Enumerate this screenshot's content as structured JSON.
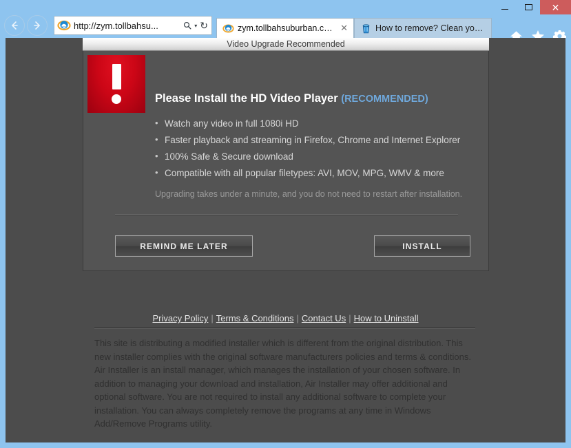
{
  "browser": {
    "window_controls": {
      "minimize": "–",
      "maximize": "□",
      "close": "✕"
    },
    "nav": {
      "back_icon": "back-arrow-icon",
      "forward_icon": "forward-arrow-icon"
    },
    "address_bar": {
      "value": "http://zym.tollbahsu...",
      "placeholder": "",
      "search_icon": "search-icon",
      "dropdown_icon": "▾",
      "refresh_icon": "↻"
    },
    "tabs": [
      {
        "label": "zym.tollbahsuburban.com",
        "icon": "ie-logo-icon",
        "close": "✕",
        "active": true
      },
      {
        "label": "How to remove? Clean your co...",
        "icon": "trash-bin-icon",
        "active": false
      }
    ],
    "toolbar_right": [
      {
        "name": "home-icon"
      },
      {
        "name": "favorites-star-icon"
      },
      {
        "name": "settings-gear-icon"
      }
    ]
  },
  "page": {
    "dialog": {
      "title": "Video Upgrade Recommended",
      "alert_icon": "exclamation-mark-icon",
      "headline": "Please Install the HD Video Player",
      "headline_suffix": "(RECOMMENDED)",
      "bullets": [
        "Watch any video in full 1080i HD",
        "Faster playback and streaming in Firefox, Chrome and Internet Explorer",
        "100% Safe & Secure download",
        "Compatible with all popular filetypes: AVI, MOV,  MPG, WMV & more"
      ],
      "subnote": "Upgrading takes under a minute, and you do not need to restart after installation.",
      "buttons": {
        "remind": "REMIND ME LATER",
        "install": "INSTALL"
      }
    },
    "footer": {
      "links": [
        "Privacy Policy",
        "Terms & Conditions",
        "Contact Us",
        "How to Uninstall"
      ],
      "separator": "|",
      "disclaimer": "This site is distributing a modified installer which is different from the original distribution. This new installer complies with the original software manufacturers policies and terms & conditions. Air Installer is an install manager, which manages the installation of your chosen software. In addition to managing your download and installation, Air Installer may offer additional and optional software. You are not required to install any additional software to complete your installation. You can always completely remove the programs at any time in Windows Add/Remove Programs utility."
    }
  },
  "colors": {
    "chrome_blue": "#8ec4ef",
    "close_red": "#cd5c5c",
    "page_bg": "#4c4c4c",
    "panel_bg": "#545454",
    "alert_red": "#cc0616",
    "recommended_blue": "#6fa8dc"
  }
}
